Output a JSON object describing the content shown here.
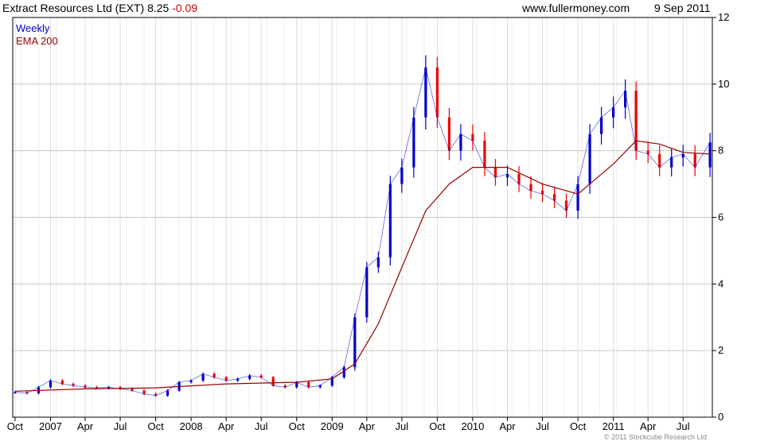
{
  "header": {
    "title": "Extract Resources Ltd (EXT)",
    "price": "8.25",
    "change": "-0.09",
    "site": "www.fullermoney.com",
    "date": "9 Sep 2011"
  },
  "legend": {
    "series1": "Weekly",
    "series2": "EMA 200"
  },
  "copyright": "© 2011 Stockcube Research Ltd",
  "colors": {
    "up": "#0000cc",
    "down": "#ee0000",
    "ema": "#990000",
    "grid": "#c8c8c8",
    "axis": "#000000"
  },
  "chart_data": {
    "type": "line",
    "title": "Extract Resources Ltd (EXT)",
    "xlabel": "",
    "ylabel": "",
    "x_ticks": [
      "Oct",
      "2007",
      "Apr",
      "Jul",
      "Oct",
      "2008",
      "Apr",
      "Jul",
      "Oct",
      "2009",
      "Apr",
      "Jul",
      "Oct",
      "2010",
      "Apr",
      "Jul",
      "Oct",
      "2011",
      "Apr",
      "Jul"
    ],
    "x_tick_dates": [
      "2006-10-01",
      "2007-01-01",
      "2007-04-01",
      "2007-07-01",
      "2007-10-01",
      "2008-01-01",
      "2008-04-01",
      "2008-07-01",
      "2008-10-01",
      "2009-01-01",
      "2009-04-01",
      "2009-07-01",
      "2009-10-01",
      "2010-01-01",
      "2010-04-01",
      "2010-07-01",
      "2010-10-01",
      "2011-01-01",
      "2011-04-01",
      "2011-07-01"
    ],
    "xlim": [
      "2006-09-25",
      "2011-09-15"
    ],
    "y_ticks": [
      0,
      2,
      4,
      6,
      8,
      10,
      12
    ],
    "ylim": [
      0,
      12
    ],
    "y_axis_side": "right",
    "grid": true,
    "legend_position": "top-left",
    "series": [
      {
        "name": "Weekly",
        "kind": "price",
        "x": [
          "2006-10-01",
          "2006-11-01",
          "2006-12-01",
          "2007-01-01",
          "2007-02-01",
          "2007-03-01",
          "2007-04-01",
          "2007-05-01",
          "2007-06-01",
          "2007-07-01",
          "2007-08-01",
          "2007-09-01",
          "2007-10-01",
          "2007-11-01",
          "2007-12-01",
          "2008-01-01",
          "2008-02-01",
          "2008-03-01",
          "2008-04-01",
          "2008-05-01",
          "2008-06-01",
          "2008-07-01",
          "2008-08-01",
          "2008-09-01",
          "2008-10-01",
          "2008-11-01",
          "2008-12-01",
          "2009-01-01",
          "2009-02-01",
          "2009-03-01",
          "2009-04-01",
          "2009-05-01",
          "2009-06-01",
          "2009-07-01",
          "2009-08-01",
          "2009-09-01",
          "2009-10-01",
          "2009-11-01",
          "2009-12-01",
          "2010-01-01",
          "2010-02-01",
          "2010-03-01",
          "2010-04-01",
          "2010-05-01",
          "2010-06-01",
          "2010-07-01",
          "2010-08-01",
          "2010-09-01",
          "2010-10-01",
          "2010-11-01",
          "2010-12-01",
          "2011-01-01",
          "2011-02-01",
          "2011-03-01",
          "2011-04-01",
          "2011-05-01",
          "2011-06-01",
          "2011-07-01",
          "2011-08-01",
          "2011-09-09"
        ],
        "values": [
          0.75,
          0.72,
          0.9,
          1.1,
          1.0,
          0.95,
          0.9,
          0.88,
          0.9,
          0.85,
          0.8,
          0.7,
          0.65,
          0.8,
          1.05,
          1.1,
          1.3,
          1.2,
          1.1,
          1.15,
          1.25,
          1.2,
          0.95,
          0.9,
          1.05,
          0.9,
          0.95,
          1.2,
          1.5,
          3.0,
          4.5,
          4.8,
          7.0,
          7.5,
          9.0,
          10.5,
          9.0,
          8.0,
          8.5,
          8.3,
          7.5,
          7.2,
          7.3,
          7.0,
          6.8,
          6.7,
          6.5,
          6.2,
          7.0,
          8.5,
          9.0,
          9.3,
          9.8,
          8.0,
          7.9,
          7.5,
          7.8,
          7.9,
          7.5,
          8.25
        ]
      },
      {
        "name": "EMA 200",
        "kind": "ema",
        "x": [
          "2006-10-01",
          "2007-04-01",
          "2007-10-01",
          "2008-04-01",
          "2008-10-01",
          "2009-01-01",
          "2009-03-01",
          "2009-05-01",
          "2009-07-01",
          "2009-09-01",
          "2009-11-01",
          "2010-01-01",
          "2010-04-01",
          "2010-07-01",
          "2010-10-01",
          "2011-01-01",
          "2011-03-01",
          "2011-05-01",
          "2011-07-01",
          "2011-09-09"
        ],
        "values": [
          0.78,
          0.85,
          0.88,
          1.0,
          1.05,
          1.15,
          1.6,
          2.8,
          4.5,
          6.2,
          7.0,
          7.5,
          7.5,
          7.0,
          6.7,
          7.6,
          8.3,
          8.2,
          7.95,
          7.9
        ]
      }
    ]
  }
}
